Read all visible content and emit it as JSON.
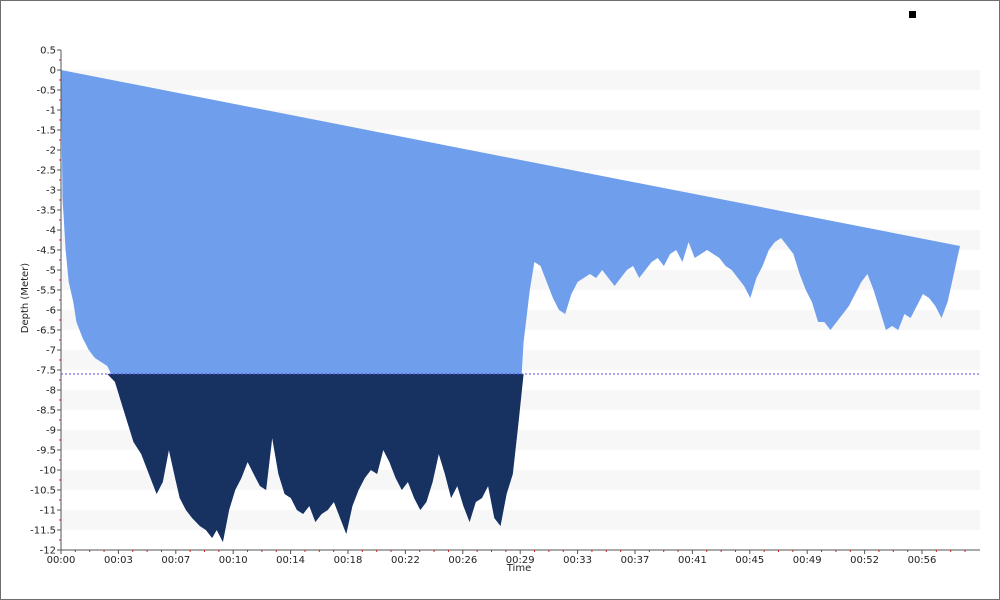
{
  "chart_data": {
    "type": "area",
    "title": "",
    "xlabel": "Time",
    "ylabel": "Depth (Meter)",
    "ylim": [
      -12,
      0.5
    ],
    "y_ticks": [
      0.5,
      0,
      -0.5,
      -1,
      -1.5,
      -2,
      -2.5,
      -3,
      -3.5,
      -4,
      -4.5,
      -5,
      -5.5,
      -6,
      -6.5,
      -7,
      -7.5,
      -8,
      -8.5,
      -9,
      -9.5,
      -10,
      -10.5,
      -11,
      -11.5,
      -12
    ],
    "xlim_minutes": [
      0,
      59.6
    ],
    "x_ticks": [
      "00:00",
      "00:03",
      "00:07",
      "00:10",
      "00:14",
      "00:18",
      "00:22",
      "00:26",
      "00:29",
      "00:33",
      "00:37",
      "00:41",
      "00:45",
      "00:49",
      "00:52",
      "00:56"
    ],
    "threshold_depth": -7.6,
    "grid": "horizontal bands",
    "legend": "top-right",
    "colors": {
      "area_above_threshold": "#6f9fec",
      "area_below_threshold": "#173260",
      "threshold_line": "#5a4fd6",
      "band": "#f7f7f7",
      "tick_minor": "#cc2222"
    },
    "series": [
      {
        "x_minutes": [
          0,
          0.1,
          0.3,
          0.5,
          0.8,
          1,
          1.4,
          1.8,
          2.2,
          2.6,
          3,
          3.5,
          3.9,
          4.3,
          4.7,
          5.2,
          5.7,
          6.2,
          6.6,
          7,
          7.4,
          7.7,
          8.1,
          8.5,
          9,
          9.4,
          9.8,
          10.1,
          10.5,
          10.9,
          11.3,
          11.7,
          12.1,
          12.5,
          12.9,
          13.3,
          13.7,
          14.1,
          14.5,
          14.9,
          15.3,
          15.7,
          16.1,
          16.5,
          16.9,
          17.3,
          17.7,
          18.1,
          18.5,
          18.9,
          19.3,
          19.7,
          20.1,
          20.5,
          20.9,
          21.3,
          21.7,
          22.1,
          22.5,
          22.9,
          23.3,
          23.7,
          24.1,
          24.5,
          24.9,
          25.3,
          25.7,
          26.1,
          26.5,
          26.9,
          27.3,
          27.7,
          28.1,
          28.5,
          28.9,
          29.3,
          29.7,
          30,
          30.4,
          30.7,
          31.1,
          31.5,
          31.9,
          32.3,
          32.7,
          33.1,
          33.5,
          33.9,
          34.3,
          34.7,
          35.1,
          35.5,
          35.9,
          36.3,
          36.7,
          37.1,
          37.5,
          37.9,
          38.3,
          38.7,
          39.1,
          39.5,
          39.9,
          40.3,
          40.7,
          41.1,
          41.5,
          41.9,
          42.3,
          42.7,
          43.1,
          43.5,
          43.9,
          44.3,
          44.7,
          45.1,
          45.5,
          45.9,
          46.3,
          46.7,
          47.1,
          47.5,
          47.9,
          48.3,
          48.7,
          49.1,
          49.5,
          49.9,
          50.3,
          50.7,
          51.1,
          51.5,
          51.9,
          52.3,
          52.7,
          53.1,
          53.5,
          53.9,
          54.3,
          54.7,
          55.1,
          55.5,
          55.9,
          56.3,
          56.7,
          57.1,
          57.5,
          57.9,
          58.3,
          58.7,
          59.1,
          59.6
        ],
        "depths": [
          0,
          -3.2,
          -4.5,
          -5.3,
          -5.8,
          -6.3,
          -6.7,
          -7,
          -7.2,
          -7.3,
          -7.4,
          -7.8,
          -8.3,
          -8.8,
          -9.3,
          -9.6,
          -10.1,
          -10.6,
          -10.3,
          -9.5,
          -10.2,
          -10.7,
          -11,
          -11.2,
          -11.4,
          -11.5,
          -11.7,
          -11.5,
          -11.8,
          -11,
          -10.5,
          -10.2,
          -9.8,
          -10.1,
          -10.4,
          -10.5,
          -9.2,
          -10.1,
          -10.6,
          -10.7,
          -11,
          -11.1,
          -10.9,
          -11.3,
          -11.1,
          -11,
          -10.8,
          -11.2,
          -11.6,
          -10.9,
          -10.5,
          -10.2,
          -10,
          -10.1,
          -9.5,
          -9.8,
          -10.2,
          -10.5,
          -10.3,
          -10.7,
          -11,
          -10.8,
          -10.3,
          -9.6,
          -10.1,
          -10.7,
          -10.4,
          -10.9,
          -11.3,
          -10.8,
          -10.7,
          -10.4,
          -11.2,
          -11.4,
          -10.6,
          -10.1,
          -8.7,
          -6.8,
          -5.5,
          -4.8,
          -4.9,
          -5.3,
          -5.7,
          -6,
          -6.1,
          -5.6,
          -5.3,
          -5.2,
          -5.1,
          -5.2,
          -5,
          -5.2,
          -5.4,
          -5.2,
          -5,
          -4.9,
          -5.2,
          -5,
          -4.8,
          -4.7,
          -4.9,
          -4.6,
          -4.5,
          -4.8,
          -4.3,
          -4.7,
          -4.6,
          -4.5,
          -4.6,
          -4.7,
          -4.9,
          -5,
          -5.2,
          -5.4,
          -5.7,
          -5.2,
          -4.9,
          -4.5,
          -4.3,
          -4.2,
          -4.4,
          -4.6,
          -5.1,
          -5.5,
          -5.8,
          -6.3,
          -6.3,
          -6.5,
          -6.3,
          -6.1,
          -5.9,
          -5.6,
          -5.3,
          -5.1,
          -5.5,
          -6,
          -6.5,
          -6.4,
          -6.5,
          -6.1,
          -6.2,
          -5.9,
          -5.6,
          -5.7,
          -5.9,
          -6.2,
          -5.8,
          -5.1,
          -4.4
        ]
      }
    ]
  }
}
